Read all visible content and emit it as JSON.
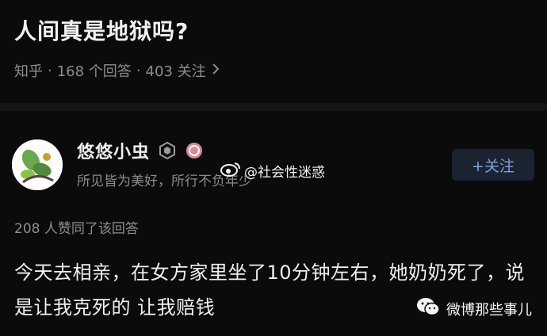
{
  "question": {
    "title": "人间真是地狱吗?",
    "source": "知乎",
    "answer_count": "168 个回答",
    "follower_count": "403 关注"
  },
  "author": {
    "name": "悠悠小虫",
    "bio": "所见皆为美好，所行不负年少",
    "follow_label": "+关注"
  },
  "answer": {
    "likes": "208 人赞同了该回答",
    "content": "今天去相亲，在女方家里坐了10分钟左右，她奶奶死了，说是让我克死的 让我赔钱"
  },
  "watermarks": {
    "weibo_handle": "@社会性迷惑",
    "wechat_account": "微博那些事儿"
  },
  "colors": {
    "background": "#0b0b0c",
    "follow_text": "#7fa3d6"
  }
}
